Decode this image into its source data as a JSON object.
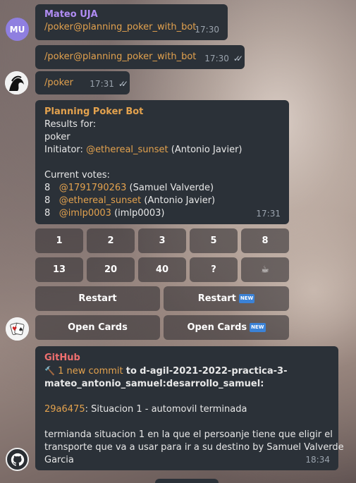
{
  "msg1": {
    "avatar_initials": "MU",
    "sender": "Mateo UJA",
    "text": "/poker@planning_poker_with_bot",
    "time": "17:30"
  },
  "msg2": {
    "text": "/poker@planning_poker_with_bot",
    "time": "17:30"
  },
  "msg3": {
    "text": "/poker",
    "time": "17:31"
  },
  "bot": {
    "sender": "Planning Poker Bot",
    "results_for": "Results for:",
    "topic": "poker",
    "initiator_label": "Initiator:",
    "initiator_handle": "@ethereal_sunset",
    "initiator_name": "(Antonio Javier)",
    "votes_label": "Current votes:",
    "votes": [
      {
        "value": "8",
        "handle": "@1791790263",
        "name": "(Samuel Valverde)"
      },
      {
        "value": "8",
        "handle": "@ethereal_sunset",
        "name": "(Antonio Javier)"
      },
      {
        "value": "8",
        "handle": "@imlp0003",
        "name": "(imlp0003)"
      }
    ],
    "time": "17:31"
  },
  "keyboard": {
    "row1": [
      "1",
      "2",
      "3",
      "5",
      "8"
    ],
    "row2": [
      "13",
      "20",
      "40",
      "?",
      "☕"
    ],
    "restart": "Restart",
    "restart_new": "Restart",
    "open_cards": "Open Cards",
    "open_cards_new": "Open Cards",
    "new_badge": "NEW"
  },
  "github": {
    "sender": "GitHub",
    "hammer_icon": "🔨",
    "commit_count": "1 new commit",
    "to": "to",
    "repo_line1": "d-agil-2021-2022-practica-3-",
    "repo_line2": "mateo_antonio_samuel:desarrollo_samuel:",
    "commit_hash": "29a6475",
    "commit_title": ": Situacion 1 - automovil terminada",
    "body_line1": "termianda situacion 1 en la que el persoanje tiene que eligir el",
    "body_line2": "transporte que va a usar para ir a su destino by Samuel Valverde",
    "body_line3": "Garcia",
    "time": "18:34"
  }
}
